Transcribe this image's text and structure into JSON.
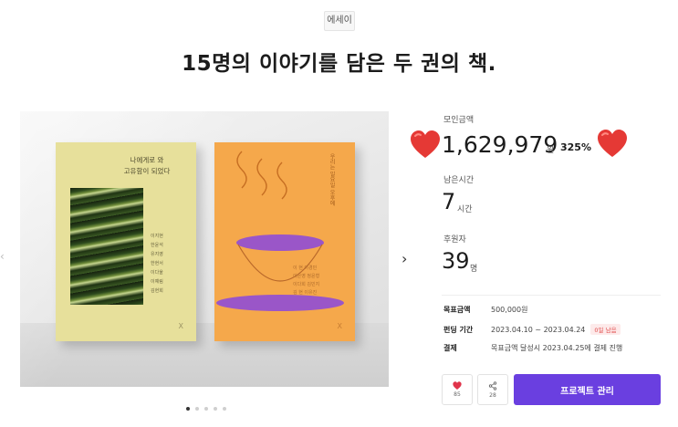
{
  "category": "에세이",
  "title": "15명의 이야기를 담은 두 권의 책.",
  "carousel": {
    "book_left": {
      "title_line1": "나에게로 와",
      "title_line2": "고유함이 되었다",
      "authors": [
        "이지현",
        "한윤석",
        "유지영",
        "한현서",
        "이다울",
        "이예림",
        "김현희"
      ],
      "mark": "X"
    },
    "book_right": {
      "title": "우리는 일요일 오후에",
      "authors": [
        "이 현  이경민",
        "이은영 정윤형",
        "이다희 김민지",
        "김 현 이유진"
      ],
      "mark": "X",
      "colors": {
        "cover": "#f5a84b",
        "accent": "#9a56c8"
      }
    },
    "dots": 5,
    "active_dot": 0
  },
  "stats": {
    "raised_label": "모인금액",
    "raised_amount": "1,629,979",
    "raised_unit": "원",
    "raised_percent": "325%",
    "time_label": "남은시간",
    "time_value": "7",
    "time_unit": "시간",
    "backers_label": "후원자",
    "backers_value": "39",
    "backers_unit": "명"
  },
  "info": {
    "goal_key": "목표금액",
    "goal_value": "500,000원",
    "period_key": "펀딩 기간",
    "period_value": "2023.04.10 ~ 2023.04.24",
    "period_badge": "0일 남음",
    "payment_key": "결제",
    "payment_value": "목표금액 달성시 2023.04.25에 결제 진행"
  },
  "actions": {
    "like_count": "85",
    "share_count": "28",
    "manage_label": "프로젝트 관리"
  },
  "colors": {
    "primary": "#6a3fe0",
    "heart": "#e53935",
    "like": "#e0344b"
  }
}
